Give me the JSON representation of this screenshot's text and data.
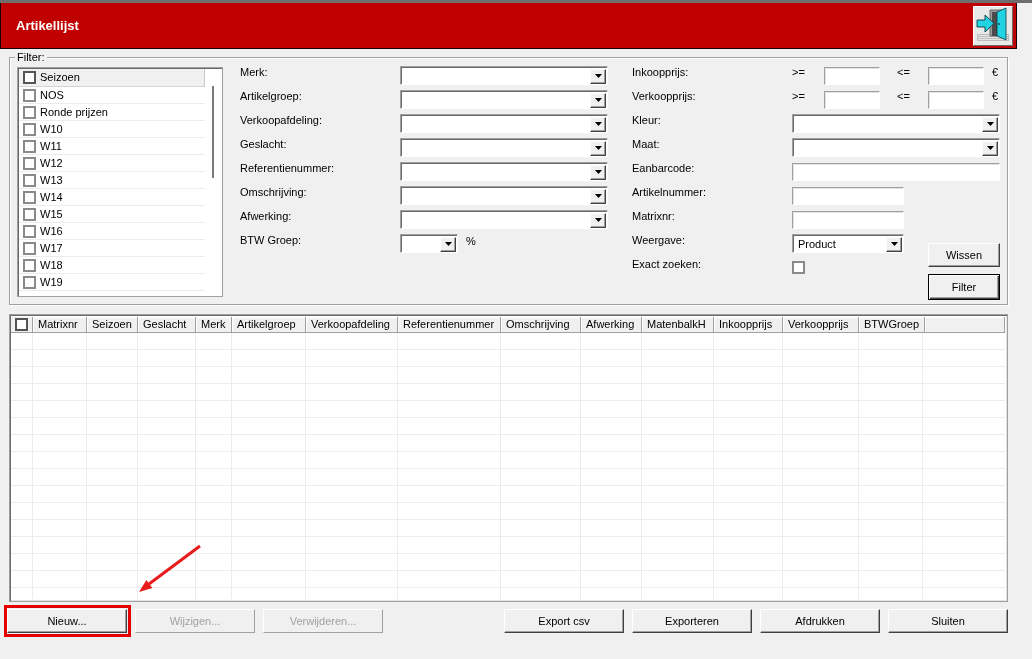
{
  "window": {
    "title": "Artikellijst"
  },
  "filter": {
    "legend": "Filter:",
    "season_list": {
      "header": {
        "label": "Seizoen",
        "checked": false
      },
      "items": [
        {
          "label": "NOS",
          "checked": false
        },
        {
          "label": "Ronde prijzen",
          "checked": false
        },
        {
          "label": "W10",
          "checked": false
        },
        {
          "label": "W11",
          "checked": false
        },
        {
          "label": "W12",
          "checked": false
        },
        {
          "label": "W13",
          "checked": false
        },
        {
          "label": "W14",
          "checked": false
        },
        {
          "label": "W15",
          "checked": false
        },
        {
          "label": "W16",
          "checked": false
        },
        {
          "label": "W17",
          "checked": false
        },
        {
          "label": "W18",
          "checked": false
        },
        {
          "label": "W19",
          "checked": false
        }
      ]
    },
    "fields_left": [
      {
        "kind": "combo",
        "label": "Merk:"
      },
      {
        "kind": "combo",
        "label": "Artikelgroep:"
      },
      {
        "kind": "combo",
        "label": "Verkoopafdeling:"
      },
      {
        "kind": "combo",
        "label": "Geslacht:"
      },
      {
        "kind": "combo",
        "label": "Referentienummer:"
      },
      {
        "kind": "combo",
        "label": "Omschrijving:"
      },
      {
        "kind": "combo",
        "label": "Afwerking:"
      },
      {
        "kind": "smallcombo",
        "label": "BTW Groep:",
        "unit": "%"
      }
    ],
    "fields_right": [
      {
        "kind": "range",
        "label": "Inkoopprijs:",
        "from_label": ">=",
        "to_label": "<=",
        "unit": "€"
      },
      {
        "kind": "range",
        "label": "Verkoopprijs:",
        "from_label": ">=",
        "to_label": "<=",
        "unit": "€"
      },
      {
        "kind": "combo",
        "label": "Kleur:"
      },
      {
        "kind": "combo",
        "label": "Maat:"
      },
      {
        "kind": "textbox",
        "label": "Eanbarcode:"
      },
      {
        "kind": "smalltextbox",
        "label": "Artikelnummer:"
      },
      {
        "kind": "smalltextbox",
        "label": "Matrixnr:"
      },
      {
        "kind": "smallcombo",
        "label": "Weergave:",
        "value": "Product"
      },
      {
        "kind": "checkbox",
        "label": "Exact zoeken:",
        "checked": false
      }
    ],
    "buttons": [
      {
        "label": "Wissen",
        "default": false
      },
      {
        "label": "Filter",
        "default": true
      }
    ]
  },
  "table": {
    "select_all": {
      "checked": false
    },
    "columns": [
      "Matrixnr",
      "Seizoen",
      "Geslacht",
      "Merk",
      "Artikelgroep",
      "Verkoopafdeling",
      "Referentienummer",
      "Omschrijving",
      "Afwerking",
      "MatenbalkH",
      "Inkoopprijs",
      "Verkoopprijs",
      "BTWGroep"
    ]
  },
  "bottom_bar": {
    "left": [
      {
        "label": "Nieuw...",
        "disabled": false,
        "highlighted": true
      },
      {
        "label": "Wijzigen...",
        "disabled": true,
        "highlighted": false
      },
      {
        "label": "Verwijderen...",
        "disabled": true,
        "highlighted": false
      }
    ],
    "right": [
      {
        "label": "Export csv",
        "disabled": false,
        "highlighted": false
      },
      {
        "label": "Exporteren",
        "disabled": false,
        "highlighted": false
      },
      {
        "label": "Afdrukken",
        "disabled": false,
        "highlighted": false
      },
      {
        "label": "Sluiten",
        "disabled": false,
        "highlighted": false
      }
    ]
  }
}
